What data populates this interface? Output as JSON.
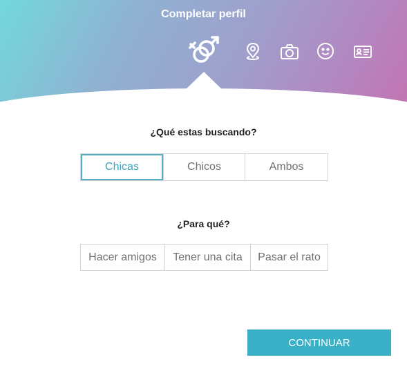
{
  "header": {
    "title": "Completar perfil",
    "steps": [
      {
        "icon": "gender-icon",
        "active": true
      },
      {
        "icon": "location-pin-icon",
        "active": false
      },
      {
        "icon": "camera-icon",
        "active": false
      },
      {
        "icon": "smiley-icon",
        "active": false
      },
      {
        "icon": "id-card-icon",
        "active": false
      }
    ]
  },
  "looking_for": {
    "question": "¿Qué estas buscando?",
    "options": [
      "Chicas",
      "Chicos",
      "Ambos"
    ],
    "selected": "Chicas"
  },
  "purpose": {
    "question": "¿Para qué?",
    "options": [
      "Hacer amigos",
      "Tener una cita",
      "Pasar el rato"
    ],
    "selected": null
  },
  "footer": {
    "continue_label": "CONTINUAR"
  },
  "colors": {
    "accent": "#3ab0c7",
    "selected_text": "#3aa6b9",
    "header_gradient": [
      "#72d9dc",
      "#9f9fcc",
      "#c472b2"
    ]
  }
}
